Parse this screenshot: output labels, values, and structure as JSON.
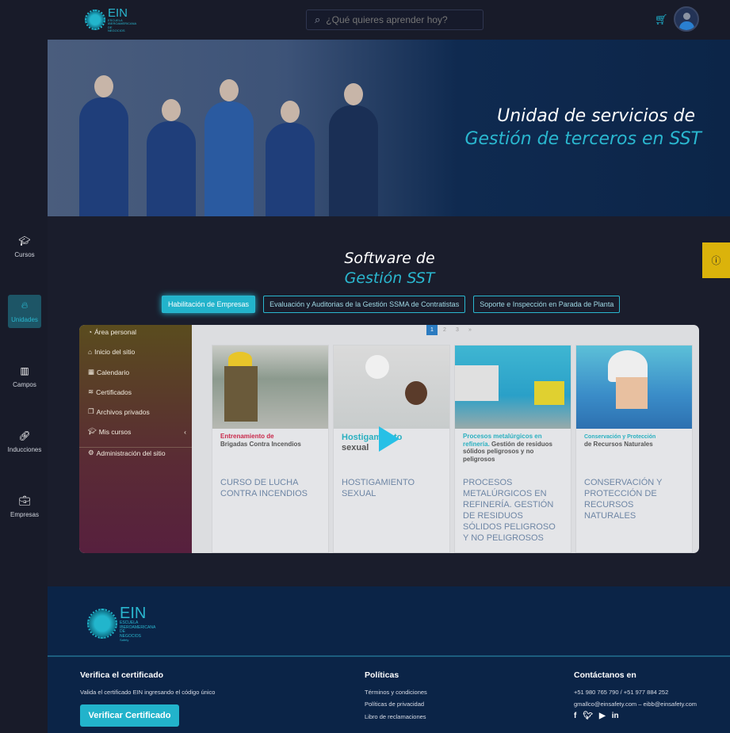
{
  "header": {
    "logo_text": "EIN",
    "logo_sub": "ESCUELA IBEROAMERICANA DE NEGOCIOS",
    "logo_tag": "Safety",
    "search_placeholder": "¿Qué quieres aprender hoy?"
  },
  "sidebar": {
    "items": [
      {
        "label": "Cursos",
        "icon": "graduation-cap-icon"
      },
      {
        "label": "Unidades",
        "icon": "fire-icon"
      },
      {
        "label": "Campos",
        "icon": "map-icon"
      },
      {
        "label": "Inducciones",
        "icon": "link-icon"
      },
      {
        "label": "Empresas",
        "icon": "briefcase-icon"
      }
    ]
  },
  "hero": {
    "line1": "Unidad de servicios de",
    "line2": "Gestión de terceros en SST"
  },
  "section": {
    "line1": "Software de",
    "line2": "Gestión SST"
  },
  "tabs": [
    "Habilitación de Empresas",
    "Evaluación y Auditorias de la Gestión SSMA de Contratistas",
    "Soporte e Inspección en Parada de Planta"
  ],
  "slide": {
    "menu": [
      "Área personal",
      "Inicio del sitio",
      "Calendario",
      "Certificados",
      "Archivos privados",
      "Mis cursos",
      "Administración del sitio"
    ],
    "pages": [
      "1",
      "2",
      "3",
      "»"
    ],
    "cards": [
      {
        "caption_a": "Entrenamiento de",
        "caption_b": "Brigadas Contra Incendios",
        "title": "CURSO DE LUCHA CONTRA INCENDIOS"
      },
      {
        "caption_a": "Hostigamiento",
        "caption_b": "sexual",
        "title": "HOSTIGAMIENTO SEXUAL"
      },
      {
        "caption_a": "Procesos metalúrgicos en refinería.",
        "caption_b": "Gestión de residuos sólidos peligrosos y no peligrosos",
        "title": "PROCESOS METALÚRGICOS EN REFINERÍA. GESTIÓN DE RESIDUOS SÓLIDOS PELIGROSO Y NO PELIGROSOS"
      },
      {
        "caption_a": "Conservación y Protección",
        "caption_b": "de Recursos Naturales",
        "title": "CONSERVACIÓN Y PROTECCIÓN DE RECURSOS NATURALES"
      }
    ]
  },
  "footer": {
    "verify_heading": "Verifica el certificado",
    "verify_text": "Valida el certificado EIN ingresando el código único",
    "verify_button": "Verificar Certificado",
    "policies_heading": "Políticas",
    "policies": [
      "Términos y condiciones",
      "Políticas de privacidad",
      "Libro de reclamaciones"
    ],
    "contact_heading": "Contáctanos en",
    "phones": "+51 980 765 790 / +51 977 884 252",
    "emails": "gmallco@einsafety.com – eibb@einsafety.com"
  },
  "colors": {
    "accent": "#22b3cb",
    "info": "#dbb30b",
    "footer": "#0b2447"
  }
}
